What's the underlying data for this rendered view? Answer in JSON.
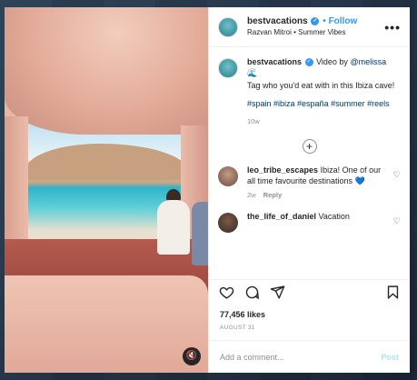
{
  "post": {
    "username": "bestvacations",
    "follow_label": "Follow",
    "subtitle": "Razvan Mitroi • Summer Vibes",
    "more_label": "•••",
    "verified_mark": "✓",
    "mute_icon": "🔇"
  },
  "caption": {
    "username": "bestvacations",
    "lead": "Video by",
    "mention": "@melissa",
    "emoji": "🌊",
    "text": "Tag who you'd eat with in this Ibiza cave!",
    "hashtags": "#spain #ibiza #españa #summer #reels",
    "time": "10w"
  },
  "load_more_label": "+",
  "comments": [
    {
      "username": "leo_tribe_escapes",
      "text": "Ibiza! One of our all time favourite destinations 💙",
      "time": "2w",
      "reply_label": "Reply",
      "heart": "♡"
    },
    {
      "username": "the_life_of_daniel",
      "text": "Vacation",
      "heart": "♡"
    }
  ],
  "engagement": {
    "likes": "77,456 likes",
    "date": "AUGUST 31"
  },
  "composer": {
    "placeholder": "Add a comment...",
    "post_label": "Post"
  }
}
